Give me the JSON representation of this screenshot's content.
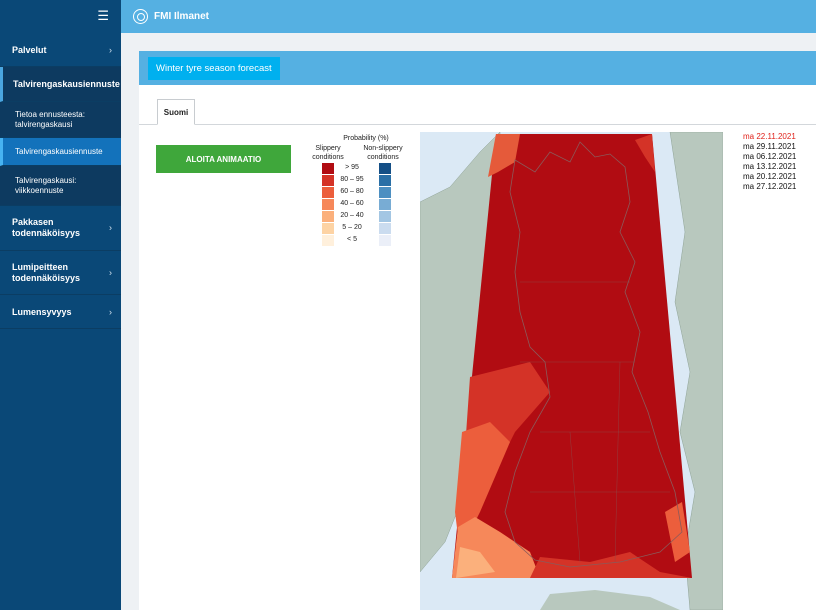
{
  "app": {
    "brand": "FMI Ilmanet"
  },
  "sidebar": {
    "menu_icon": "☰",
    "items": [
      {
        "label": "Palvelut",
        "expandable": true
      },
      {
        "label": "Talvirengaskausiennuste",
        "expandable": false
      },
      {
        "label": "Tietoa ennusteesta: talvirengaskausi",
        "expandable": false
      },
      {
        "label": "Talvirengaskausiennuste",
        "expandable": false,
        "active": true
      },
      {
        "label": "Talvirengaskausi: viikkoennuste",
        "expandable": false
      },
      {
        "label": "Pakkasen todennäköisyys",
        "expandable": true
      },
      {
        "label": "Lumipeitteen todennäköisyys",
        "expandable": true
      },
      {
        "label": "Lumensyvyys",
        "expandable": true
      }
    ]
  },
  "panel": {
    "title": "Winter tyre season forecast",
    "tab": "Suomi",
    "animation_button": "ALOITA ANIMAATIO"
  },
  "legend": {
    "title": "Probability (%)",
    "left_header": "Slippery conditions",
    "right_header": "Non-slippery conditions",
    "bins": [
      "> 95",
      "80 – 95",
      "60 – 80",
      "40 – 60",
      "20 – 40",
      "5 – 20",
      "< 5"
    ],
    "slippery_colors": [
      "#b10c12",
      "#d43327",
      "#ec5e3c",
      "#f6885a",
      "#fbb07c",
      "#fdd3a4",
      "#fff0dc"
    ],
    "non_slippery_colors": [
      "#144f86",
      "#2a6fa6",
      "#4d8fc1",
      "#78acd4",
      "#a3c6e3",
      "#cbdcef",
      "#ebeff8"
    ]
  },
  "dates": {
    "items": [
      "ma 22.11.2021",
      "ma 29.11.2021",
      "ma 06.12.2021",
      "ma 13.12.2021",
      "ma 20.12.2021",
      "ma 27.12.2021"
    ],
    "selected_index": 0
  },
  "colors": {
    "sidebar": "#0a4877",
    "topbar": "#55b0e2",
    "title_badge": "#00b0ef",
    "button": "#3fa73b",
    "selected_date": "#e0221b"
  }
}
